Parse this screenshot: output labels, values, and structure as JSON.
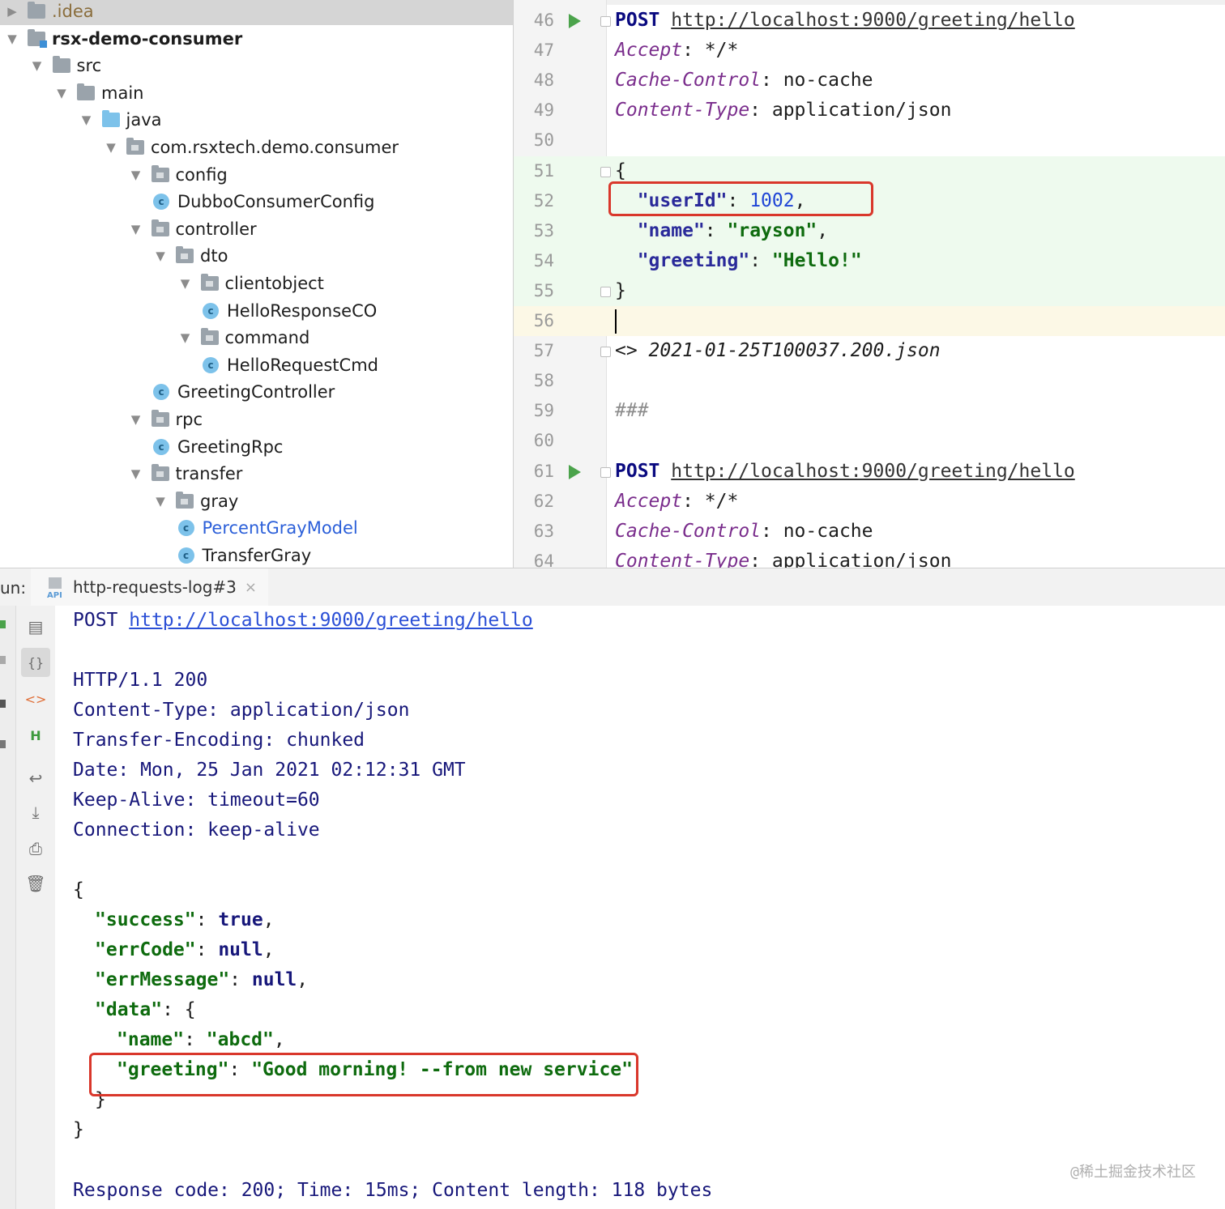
{
  "project_tree": {
    "items": [
      {
        "label": ".idea",
        "kind": "folder-idea",
        "expanded": false
      },
      {
        "label": "rsx-demo-consumer",
        "kind": "module",
        "expanded": true
      },
      {
        "label": "src",
        "kind": "folder",
        "expanded": true
      },
      {
        "label": "main",
        "kind": "folder",
        "expanded": true
      },
      {
        "label": "java",
        "kind": "source-root",
        "expanded": true
      },
      {
        "label": "com.rsxtech.demo.consumer",
        "kind": "package",
        "expanded": true
      },
      {
        "label": "config",
        "kind": "package",
        "expanded": true
      },
      {
        "label": "DubboConsumerConfig",
        "kind": "class"
      },
      {
        "label": "controller",
        "kind": "package",
        "expanded": true
      },
      {
        "label": "dto",
        "kind": "package",
        "expanded": true
      },
      {
        "label": "clientobject",
        "kind": "package",
        "expanded": true
      },
      {
        "label": "HelloResponseCO",
        "kind": "class"
      },
      {
        "label": "command",
        "kind": "package",
        "expanded": true
      },
      {
        "label": "HelloRequestCmd",
        "kind": "class"
      },
      {
        "label": "GreetingController",
        "kind": "class"
      },
      {
        "label": "rpc",
        "kind": "package",
        "expanded": true
      },
      {
        "label": "GreetingRpc",
        "kind": "class"
      },
      {
        "label": "transfer",
        "kind": "package",
        "expanded": true
      },
      {
        "label": "gray",
        "kind": "package",
        "expanded": true
      },
      {
        "label": "PercentGrayModel",
        "kind": "class"
      },
      {
        "label": "TransferGray",
        "kind": "class"
      }
    ]
  },
  "editor": {
    "lines": [
      {
        "n": "46",
        "run": true,
        "fold": true,
        "post": "POST",
        "url": "http://localhost:9000/greeting/hello"
      },
      {
        "n": "47",
        "hname": "Accept",
        "hval": ": */*"
      },
      {
        "n": "48",
        "hname": "Cache-Control",
        "hval": ": no-cache"
      },
      {
        "n": "49",
        "hname": "Content-Type",
        "hval": ": application/json"
      },
      {
        "n": "50"
      },
      {
        "n": "51",
        "fold": true,
        "json": true,
        "plain": "{"
      },
      {
        "n": "52",
        "json": true,
        "key": "\"userId\"",
        "sep": ": ",
        "num": "1002",
        "tail": ","
      },
      {
        "n": "53",
        "json": true,
        "key": "\"name\"",
        "sep": ": ",
        "str": "\"rayson\"",
        "tail": ","
      },
      {
        "n": "54",
        "json": true,
        "key": "\"greeting\"",
        "sep": ": ",
        "str": "\"Hello!\""
      },
      {
        "n": "55",
        "fold": true,
        "json": true,
        "plain": "}"
      },
      {
        "n": "56",
        "cursor": true
      },
      {
        "n": "57",
        "fold": true,
        "italic": "<> 2021-01-25T100037.200.json"
      },
      {
        "n": "58"
      },
      {
        "n": "59",
        "comment": "###"
      },
      {
        "n": "60"
      },
      {
        "n": "61",
        "run": true,
        "fold": true,
        "post": "POST",
        "url": "http://localhost:9000/greeting/hello"
      },
      {
        "n": "62",
        "hname": "Accept",
        "hval": ": */*"
      },
      {
        "n": "63",
        "hname": "Cache-Control",
        "hval": ": no-cache"
      },
      {
        "n": "64",
        "hname": "Content-Type",
        "hval": ": application/json"
      }
    ]
  },
  "run_panel": {
    "label": "un:",
    "tab_label": "http-requests-log#3",
    "tab_icon_text": "API",
    "close_glyph": "×",
    "toolbar_icons": [
      "document-icon",
      "json-format-icon",
      "html-view-icon",
      "header-view-icon",
      "soft-wrap-icon",
      "scroll-to-end-icon",
      "print-icon",
      "trash-icon"
    ]
  },
  "console": {
    "request_method": "POST",
    "request_url": "http://localhost:9000/greeting/hello",
    "status_line": "HTTP/1.1 200",
    "headers": [
      "Content-Type: application/json",
      "Transfer-Encoding: chunked",
      "Date: Mon, 25 Jan 2021 02:12:31 GMT",
      "Keep-Alive: timeout=60",
      "Connection: keep-alive"
    ],
    "body": {
      "open": "{",
      "success_key": "\"success\"",
      "success_val": "true",
      "errcode_key": "\"errCode\"",
      "errcode_val": "null",
      "errmsg_key": "\"errMessage\"",
      "errmsg_val": "null",
      "data_key": "\"data\"",
      "data_open": "{",
      "name_key": "\"name\"",
      "name_val": "\"abcd\"",
      "greeting_key": "\"greeting\"",
      "greeting_val": "\"Good morning! --from new service\"",
      "data_close": "}",
      "close": "}"
    },
    "summary": "Response code: 200; Time: 15ms; Content length: 118 bytes",
    "watermark": "@稀土掘金技术社区"
  },
  "colors": {
    "highlight_box": "#d9372b",
    "json_bg": "#eefaee",
    "cursor_line_bg": "#fcf8e6"
  }
}
